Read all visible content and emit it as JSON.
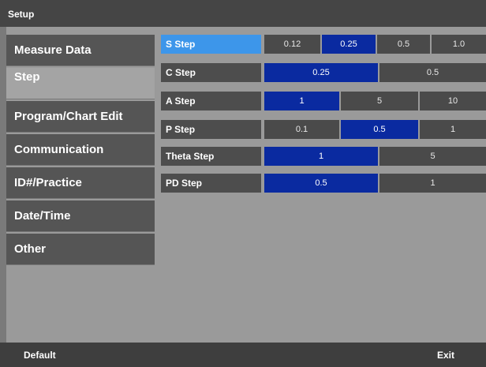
{
  "window": {
    "title": "Setup"
  },
  "sidebar": {
    "items": [
      {
        "label": "Measure Data",
        "active": false
      },
      {
        "label": "Step",
        "active": true
      },
      {
        "label": "Program/Chart Edit",
        "active": false
      },
      {
        "label": "Communication",
        "active": false
      },
      {
        "label": "ID#/Practice",
        "active": false
      },
      {
        "label": "Date/Time",
        "active": false
      },
      {
        "label": "Other",
        "active": false
      }
    ]
  },
  "steps": {
    "rows": [
      {
        "label": "S Step",
        "options": [
          "0.12",
          "0.25",
          "0.5",
          "1.0"
        ],
        "selected_index": 1
      },
      {
        "label": "C Step",
        "options": [
          "0.25",
          "0.5"
        ],
        "selected_index": 0
      },
      {
        "label": "A Step",
        "options": [
          "1",
          "5",
          "10"
        ],
        "selected_index": 0
      },
      {
        "label": "P Step",
        "options": [
          "0.1",
          "0.5",
          "1"
        ],
        "selected_index": 1
      },
      {
        "label": "Theta Step",
        "options": [
          "1",
          "5"
        ],
        "selected_index": 0
      },
      {
        "label": "PD Step",
        "options": [
          "0.5",
          "1"
        ],
        "selected_index": 0
      }
    ]
  },
  "footer": {
    "default_label": "Default",
    "exit_label": "Exit"
  },
  "colors": {
    "selected_option": "#0a2aa0",
    "highlighted_row": "#3d96ea",
    "panel_background": "#9a9a9a"
  }
}
